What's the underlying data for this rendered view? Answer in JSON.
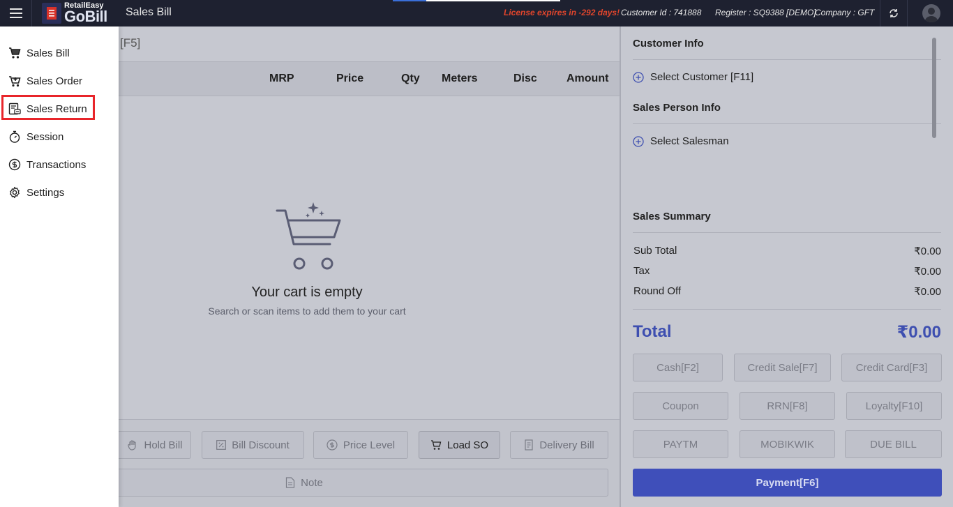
{
  "header": {
    "logo_small": "RetailEasy",
    "logo_main": "GoBill",
    "title": "Sales Bill",
    "license": "License expires in -292 days!",
    "customer_id": "Customer Id : 741888",
    "register": "Register : SQ9388 [DEMO]",
    "company": "Company : GFT"
  },
  "main": {
    "search_hint": "[F5]",
    "columns": [
      "MRP",
      "Price",
      "Qty",
      "Meters",
      "Disc",
      "Amount"
    ],
    "empty_title": "Your cart is empty",
    "empty_sub": "Search or scan items to add them to your cart",
    "actions": {
      "hold_bill": "Hold Bill",
      "bill_discount": "Bill Discount",
      "price_level": "Price Level",
      "load_so": "Load SO",
      "delivery_bill": "Delivery Bill",
      "note": "Note"
    }
  },
  "right": {
    "customer_info": "Customer Info",
    "select_customer": "Select Customer [F11]",
    "sales_person_info": "Sales Person Info",
    "select_salesman": "Select Salesman",
    "sales_summary": "Sales Summary",
    "sub_total_label": "Sub Total",
    "sub_total": "₹0.00",
    "tax_label": "Tax",
    "tax": "₹0.00",
    "round_off_label": "Round Off",
    "round_off": "₹0.00",
    "total_label": "Total",
    "total": "₹0.00",
    "payments": {
      "cash": "Cash[F2]",
      "credit_sale": "Credit Sale[F7]",
      "credit_card": "Credit Card[F3]",
      "coupon": "Coupon",
      "rrn": "RRN[F8]",
      "loyalty": "Loyalty[F10]",
      "paytm": "PAYTM",
      "mobikwik": "MOBIKWIK",
      "due_bill": "DUE BILL"
    },
    "payment_button": "Payment[F6]"
  },
  "drawer": {
    "items": [
      {
        "label": "Sales Bill",
        "icon": "cart-icon"
      },
      {
        "label": "Sales Order",
        "icon": "cart-plus-icon"
      },
      {
        "label": "Sales Return",
        "icon": "return-receipt-icon"
      },
      {
        "label": "Session",
        "icon": "stopwatch-icon"
      },
      {
        "label": "Transactions",
        "icon": "dollar-circle-icon"
      },
      {
        "label": "Settings",
        "icon": "gear-icon"
      }
    ]
  },
  "colors": {
    "topbar": "#1e2130",
    "accent": "#3f4fba",
    "license": "#e0452c",
    "highlight": "#e8252a"
  }
}
